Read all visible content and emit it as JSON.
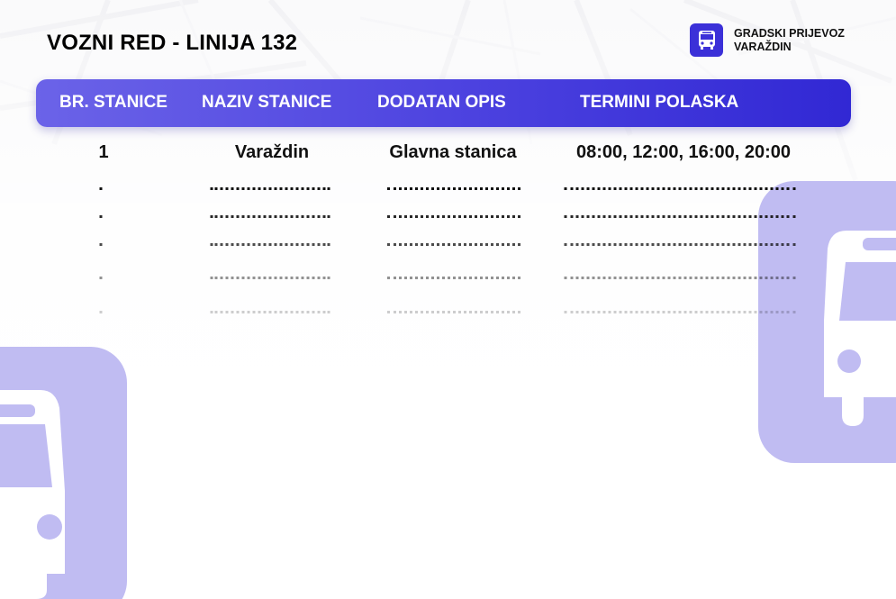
{
  "document": {
    "title": "VOZNI RED - LINIJA 132"
  },
  "logo": {
    "line1": "GRADSKI PRIJEVOZ",
    "line2": "VARAŽDIN",
    "icon": "bus-icon"
  },
  "table": {
    "headers": [
      "BR. STANICE",
      "NAZIV STANICE",
      "DODATAN OPIS",
      "TERMINI POLASKA"
    ],
    "rows": [
      {
        "number": "1",
        "station": "Varaždin",
        "description": "Glavna stanica",
        "departures": "08:00, 12:00, 16:00, 20:00"
      }
    ],
    "blank_rows": 5
  },
  "colors": {
    "accent": "#3b30d8",
    "header_start": "#6b63e8",
    "header_end": "#3128d4",
    "deco": "#c0bcf2"
  }
}
